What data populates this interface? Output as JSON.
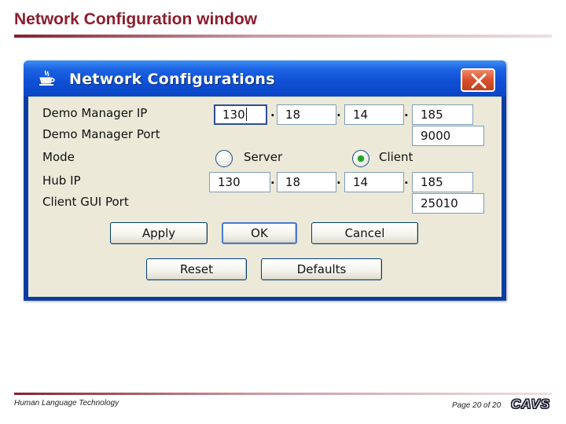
{
  "slide": {
    "title": "Network Configuration window",
    "footer_left": "Human Language Technology",
    "footer_right": "Page 20 of 20",
    "logo_text": "CAVS"
  },
  "dialog": {
    "title": "Network Configurations",
    "app_icon": "java-coffee-cup-icon",
    "close_icon": "close-x-icon"
  },
  "form": {
    "demo_manager_ip": {
      "label": "Demo Manager IP",
      "octets": [
        "130",
        "18",
        "14",
        "185"
      ]
    },
    "demo_manager_port": {
      "label": "Demo Manager Port",
      "value": "9000"
    },
    "mode": {
      "label": "Mode",
      "options": [
        "Server",
        "Client"
      ],
      "selected": "Client"
    },
    "hub_ip": {
      "label": "Hub IP",
      "octets": [
        "130",
        "18",
        "14",
        "185"
      ]
    },
    "client_gui_port": {
      "label": "Client GUI Port",
      "value": "25010"
    },
    "ip_separator": "."
  },
  "buttons": {
    "apply": "Apply",
    "ok": "OK",
    "cancel": "Cancel",
    "reset": "Reset",
    "defaults": "Defaults"
  },
  "colors": {
    "slide_accent": "#8b1e2e",
    "titlebar": "#0e4fd4",
    "dialog_background": "#ece9d8",
    "radio_selected": "#22a32a",
    "close_button": "#d9502d"
  }
}
